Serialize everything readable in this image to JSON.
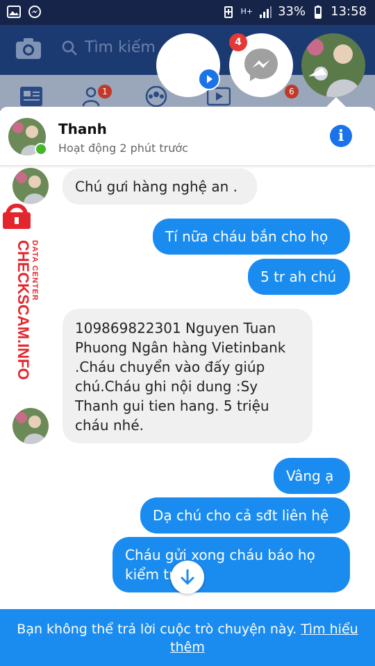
{
  "status_bar": {
    "battery": "33%",
    "time": "13:58",
    "network": "H+"
  },
  "facebook_bg": {
    "search_placeholder": "Tìm kiếm",
    "tab_badges": [
      "1",
      "6"
    ]
  },
  "chat_heads": {
    "messenger_badge": "4"
  },
  "chat": {
    "contact_name": "Thanh",
    "contact_status": "Hoạt động 2 phút trước"
  },
  "messages": [
    {
      "dir": "in",
      "text": "Chú gưi hàng nghệ an ."
    },
    {
      "dir": "out",
      "text": "Tí nữa cháu bắn cho họ"
    },
    {
      "dir": "out",
      "text": "5 tr ah chú"
    },
    {
      "dir": "in",
      "text": "109869822301 Nguyen Tuan Phuong Ngân hàng Vietinbank .Cháu chuyển vào đấy giúp chú.Cháu ghi nội dung :Sy Thanh gui tien hang. 5 triệu cháu nhé."
    },
    {
      "dir": "out",
      "text": "Vâng ạ"
    },
    {
      "dir": "out",
      "text": "Dạ chú cho cả sđt liên hệ"
    },
    {
      "dir": "out",
      "text": "Cháu gửi xong cháu báo họ kiểm tra"
    }
  ],
  "watermark": {
    "brand": "CHECKSCAM.INFO",
    "sub": "DATA CENTER"
  },
  "footer": {
    "notice": "Bạn không thể trả lời cuộc trò chuyện này.",
    "link": "Tìm hiểu thêm"
  },
  "colors": {
    "accent": "#1a8cf0",
    "status_bar": "#17244a",
    "online": "#42b72a",
    "badge": "#e53935",
    "watermark": "#e3262e"
  }
}
